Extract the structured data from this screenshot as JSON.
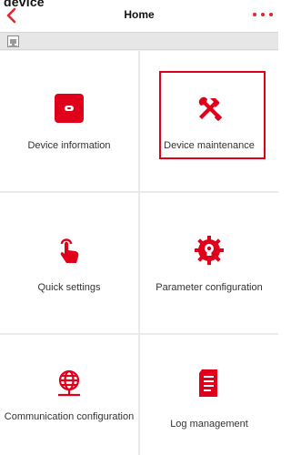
{
  "clipped_text": "device",
  "header": {
    "title": "Home",
    "back_icon": "chevron-left-icon",
    "more_icon": "more-icon"
  },
  "strip": {
    "icon": "device-list-icon"
  },
  "tiles": [
    {
      "label": "Device information",
      "icon": "device-info-icon",
      "selected": false
    },
    {
      "label": "Device maintenance",
      "icon": "tools-icon",
      "selected": true
    },
    {
      "label": "Quick settings",
      "icon": "tap-icon",
      "selected": false
    },
    {
      "label": "Parameter configuration",
      "icon": "lightbulb-gear-icon",
      "selected": false
    },
    {
      "label": "Communication configuration",
      "icon": "globe-network-icon",
      "selected": false
    },
    {
      "label": "Log management",
      "icon": "log-document-icon",
      "selected": false
    }
  ],
  "colors": {
    "accent": "#e0001a",
    "background": "#f0f0f0"
  }
}
